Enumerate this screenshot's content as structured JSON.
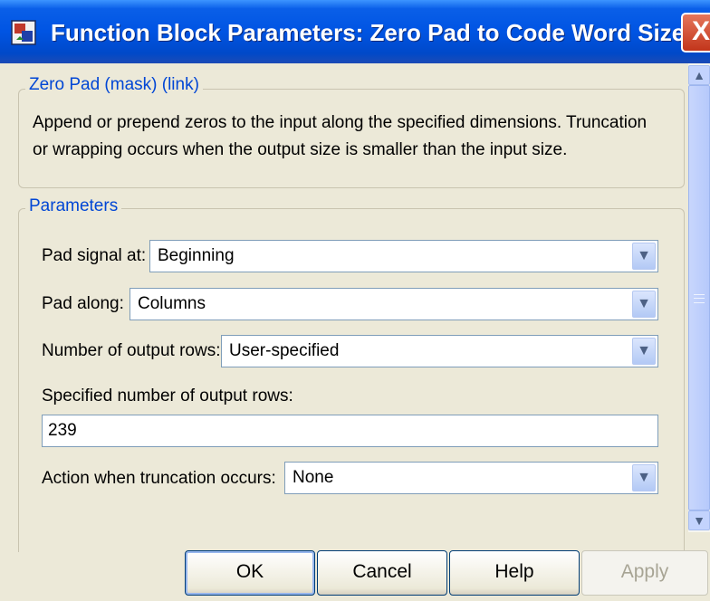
{
  "window": {
    "title": "Function Block Parameters: Zero Pad to Code Word Size",
    "close_glyph": "X",
    "icon": "simulink-block-icon"
  },
  "description_group": {
    "legend": "Zero Pad (mask) (link)",
    "lines": [
      "Append or prepend zeros to the input along the specified dimensions.  Truncation",
      "or wrapping occurs when the output size is smaller than the input size."
    ]
  },
  "parameters_group": {
    "legend": "Parameters",
    "pad_signal_at": {
      "label": "Pad signal at:",
      "value": "Beginning"
    },
    "pad_along": {
      "label": "Pad along:",
      "value": "Columns"
    },
    "num_output_rows": {
      "label": "Number of output rows:",
      "value": "User-specified"
    },
    "specified_rows": {
      "label": "Specified number of output rows:",
      "value": "239"
    },
    "truncation_action": {
      "label": "Action when truncation occurs:",
      "value": "None"
    }
  },
  "buttons": {
    "ok": "OK",
    "cancel": "Cancel",
    "help": "Help",
    "apply": "Apply"
  },
  "colors": {
    "titlebar": "#0054e3",
    "legend_text": "#0046d5",
    "dialog_bg": "#ece9d8"
  }
}
